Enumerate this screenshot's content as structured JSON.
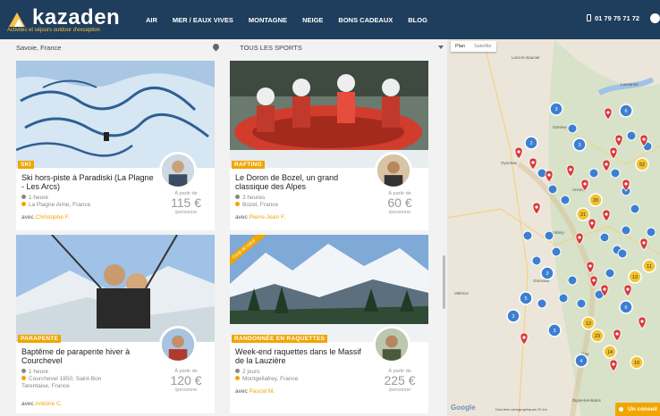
{
  "header": {
    "brand": "kazaden",
    "tagline": "Activités et séjours outdoor d'exception",
    "nav": [
      "AIR",
      "MER / EAUX VIVES",
      "MONTAGNE",
      "NEIGE",
      "BONS CADEAUX",
      "BLOG"
    ],
    "phone": "01 79 75 71 72"
  },
  "filters": {
    "location": "Savoie, France",
    "sport": "TOUS LES SPORTS"
  },
  "cards": [
    {
      "category": "SKI",
      "title": "Ski hors-piste à Paradiski (La Plagne - Les Arcs)",
      "duration": "1 heure",
      "place": "La Plagne Aime, France",
      "guide_prefix": "avec",
      "guide": "Christophe F.",
      "price_from": "À partir de",
      "price": "115 €",
      "price_unit": "/personne"
    },
    {
      "category": "RAFTING",
      "title": "Le Doron de Bozel, un grand classique des Alpes",
      "duration": "3 heures",
      "place": "Bozel, France",
      "guide_prefix": "avec",
      "guide": "Pierre-Jean F.",
      "price_from": "À partir de",
      "price": "60 €",
      "price_unit": "/personne"
    },
    {
      "category": "PARAPENTE",
      "title": "Baptême de parapente hiver à Courchevel",
      "duration": "1 heure",
      "place": "Courchevel 1850, Saint-Bon Tarentaise, France",
      "guide_prefix": "avec",
      "guide": "Antoine C.",
      "price_from": "À partir de",
      "price": "120 €",
      "price_unit": "/personne"
    },
    {
      "category": "RANDONNÉE EN RAQUETTES",
      "ribbon": "Coup de cœur",
      "title": "Week-end raquettes dans le Massif de la Lauzière",
      "duration": "2 jours",
      "place": "Montgellafrey, France",
      "guide_prefix": "avec",
      "guide": "Pascal M.",
      "price_from": "À partir de",
      "price": "225 €",
      "price_unit": "/personne"
    }
  ],
  "map": {
    "tabs": [
      "Plan",
      "Satellite"
    ],
    "google": "Google",
    "copyright": "Données cartographiques   20 km",
    "place_labels": [
      "Lons-le-Saunier",
      "Lausanne",
      "Genève",
      "Annecy",
      "Chambéry",
      "Grenoble",
      "Valence",
      "Gap",
      "Digne-les-Bains",
      "Oyonnax"
    ],
    "cluster_counts": [
      "3",
      "2",
      "3",
      "6",
      "21",
      "20",
      "52",
      "13",
      "5",
      "3",
      "12",
      "23",
      "14",
      "10",
      "11",
      "3",
      "2",
      "4",
      "6"
    ]
  },
  "chat": {
    "label": "Un conseil ?"
  },
  "colors": {
    "header": "#1f3d5c",
    "accent": "#f0a500",
    "cluster_blue": "#3d7fd1",
    "pin_red": "#d9393a"
  }
}
